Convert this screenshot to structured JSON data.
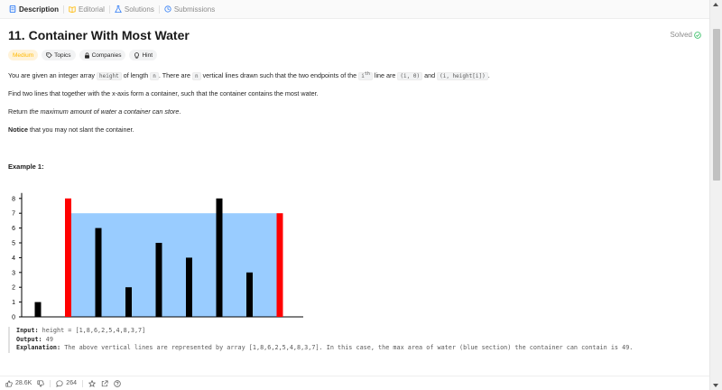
{
  "tabs": [
    {
      "label": "Description",
      "icon": "description-icon",
      "color": "#2f7cf6"
    },
    {
      "label": "Editorial",
      "icon": "book-icon",
      "color": "#ffb800"
    },
    {
      "label": "Solutions",
      "icon": "flask-icon",
      "color": "#2f7cf6"
    },
    {
      "label": "Submissions",
      "icon": "history-icon",
      "color": "#2f7cf6"
    }
  ],
  "problem": {
    "title": "11. Container With Most Water",
    "status": "Solved",
    "status_color": "#2cbb5d",
    "chips": {
      "difficulty": "Medium",
      "topics": "Topics",
      "companies": "Companies",
      "hint": "Hint"
    },
    "description": {
      "p1_a": "You are given an integer array ",
      "p1_code1": "height",
      "p1_b": " of length ",
      "p1_code2": "n",
      "p1_c": ". There are ",
      "p1_code3": "n",
      "p1_d": " vertical lines drawn such that the two endpoints of the ",
      "p1_code4": "i",
      "p1_sup": "th",
      "p1_e": " line are ",
      "p1_code5": "(i, 0)",
      "p1_f": " and ",
      "p1_code6": "(i, height[i])",
      "p1_g": ".",
      "p2": "Find two lines that together with the x-axis form a container, such that the container contains the most water.",
      "p3_a": "Return ",
      "p3_em": "the maximum amount of water a container can store",
      "p3_b": ".",
      "p4_b": "Notice",
      "p4_rest": " that you may not slant the container."
    },
    "example": {
      "title": "Example 1:",
      "input_label": "Input:",
      "input_value": " height = [1,8,6,2,5,4,8,3,7]",
      "output_label": "Output:",
      "output_value": " 49",
      "explanation_label": "Explanation:",
      "explanation_value": " The above vertical lines are represented by array [1,8,6,2,5,4,8,3,7]. In this case, the max area of water (blue section) the container can contain is 49."
    }
  },
  "chart_data": {
    "type": "bar",
    "values": [
      1,
      8,
      6,
      2,
      5,
      4,
      8,
      3,
      7
    ],
    "highlight_indices": [
      1,
      8
    ],
    "water_level": 7,
    "ylim": [
      0,
      8
    ],
    "yticks": [
      "0",
      "1",
      "2",
      "3",
      "4",
      "5",
      "6",
      "7",
      "8"
    ],
    "bar_color": "#000000",
    "highlight_color": "#ff0000",
    "water_color": "#99ccff"
  },
  "footer": {
    "likes": "28.6K",
    "comments": "264"
  }
}
